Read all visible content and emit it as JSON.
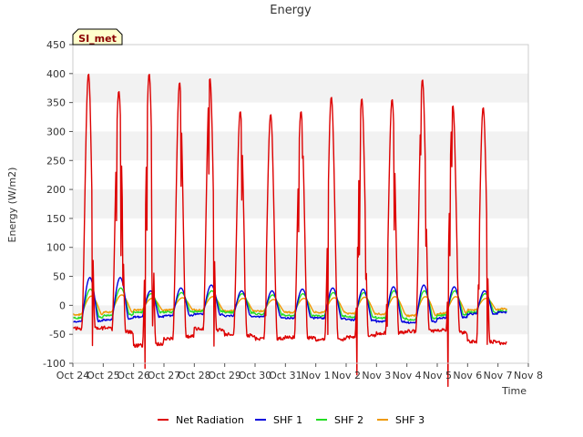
{
  "chart_data": {
    "type": "line",
    "title": "Energy",
    "xlabel": "Time",
    "ylabel": "Energy (W/m2)",
    "badge": "SI_met",
    "x_ticks": [
      "Oct 24",
      "Oct 25",
      "Oct 26",
      "Oct 27",
      "Oct 28",
      "Oct 29",
      "Oct 30",
      "Oct 31",
      "Nov 1",
      "Nov 2",
      "Nov 3",
      "Nov 4",
      "Nov 5",
      "Nov 6",
      "Nov 7",
      "Nov 8"
    ],
    "y_ticks": [
      "-100",
      "-50",
      "0",
      "50",
      "100",
      "150",
      "200",
      "250",
      "300",
      "350",
      "400",
      "450"
    ],
    "xlim": [
      "2023-10-24",
      "2023-11-08"
    ],
    "ylim": [
      -100,
      450
    ],
    "grid": "horizontal bands",
    "legend_position": "bottom",
    "daily_peaks": {
      "days": [
        "Oct 24",
        "Oct 25",
        "Oct 26",
        "Oct 27",
        "Oct 28",
        "Oct 29",
        "Oct 30",
        "Oct 31",
        "Nov 1",
        "Nov 2",
        "Nov 3",
        "Nov 4",
        "Nov 5",
        "Nov 6",
        "Nov 7"
      ],
      "net_radiation_peak": [
        400,
        370,
        400,
        385,
        392,
        335,
        330,
        335,
        360,
        357,
        356,
        390,
        345,
        342,
        0
      ],
      "net_radiation_night": [
        -40,
        -38,
        -70,
        -58,
        -40,
        -50,
        -58,
        -55,
        -60,
        -55,
        -48,
        -45,
        -42,
        -62,
        -65
      ],
      "shf1_peak": [
        48,
        48,
        25,
        30,
        35,
        25,
        25,
        28,
        30,
        28,
        32,
        35,
        32,
        25,
        0
      ],
      "shf1_night": [
        -28,
        -25,
        -20,
        -18,
        -15,
        -18,
        -20,
        -22,
        -22,
        -25,
        -28,
        -30,
        -22,
        -15,
        -12
      ],
      "shf2_peak": [
        28,
        30,
        20,
        22,
        25,
        20,
        18,
        20,
        22,
        22,
        25,
        25,
        25,
        20,
        0
      ],
      "shf2_night": [
        -22,
        -18,
        -12,
        -12,
        -10,
        -12,
        -15,
        -18,
        -18,
        -20,
        -22,
        -25,
        -18,
        -12,
        -10
      ],
      "shf3_peak": [
        16,
        18,
        12,
        13,
        15,
        12,
        10,
        12,
        13,
        14,
        15,
        15,
        15,
        12,
        0
      ],
      "shf3_night": [
        -16,
        -12,
        -8,
        -8,
        -8,
        -10,
        -10,
        -12,
        -12,
        -14,
        -15,
        -18,
        -14,
        -8,
        -6
      ]
    },
    "series": [
      {
        "name": "Net Radiation",
        "color": "#dd0000"
      },
      {
        "name": "SHF 1",
        "color": "#0000dd"
      },
      {
        "name": "SHF 2",
        "color": "#22dd22"
      },
      {
        "name": "SHF 3",
        "color": "#ee9900"
      }
    ]
  }
}
